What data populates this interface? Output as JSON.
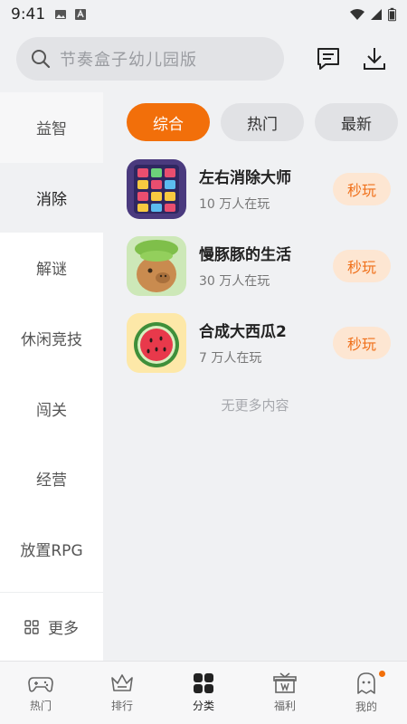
{
  "status_bar": {
    "time": "9:41"
  },
  "header": {
    "search_placeholder": "节奏盒子幼儿园版"
  },
  "sidebar": {
    "items": [
      {
        "label": "益智"
      },
      {
        "label": "消除"
      },
      {
        "label": "解谜"
      },
      {
        "label": "休闲竞技"
      },
      {
        "label": "闯关"
      },
      {
        "label": "经营"
      },
      {
        "label": "放置RPG"
      }
    ],
    "more_label": "更多",
    "active_index": 1
  },
  "filters": {
    "tabs": [
      {
        "label": "综合"
      },
      {
        "label": "热门"
      },
      {
        "label": "最新"
      }
    ],
    "active_index": 0
  },
  "games": [
    {
      "name": "左右消除大师",
      "players": "10 万人在玩",
      "action": "秒玩"
    },
    {
      "name": "慢豚豚的生活",
      "players": "30 万人在玩",
      "action": "秒玩"
    },
    {
      "name": "合成大西瓜2",
      "players": "7 万人在玩",
      "action": "秒玩"
    }
  ],
  "list_end_text": "无更多内容",
  "bottom_nav": {
    "items": [
      {
        "label": "热门"
      },
      {
        "label": "排行"
      },
      {
        "label": "分类"
      },
      {
        "label": "福利"
      },
      {
        "label": "我的"
      }
    ],
    "active_index": 2
  },
  "colors": {
    "accent": "#f26f0a",
    "play_button_bg": "#fde6d2",
    "background": "#f0f1f3"
  }
}
